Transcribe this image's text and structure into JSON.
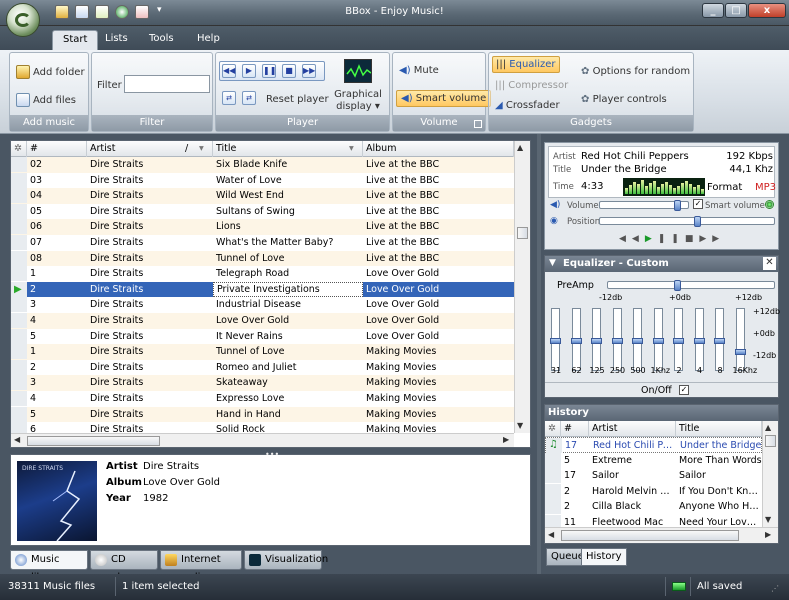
{
  "window": {
    "title": "BBox - Enjoy Music!",
    "close_label": "x",
    "min_label": "_",
    "max_label": "□"
  },
  "ribbon": {
    "tabs": [
      "Start",
      "Lists",
      "Tools",
      "Help"
    ],
    "add_music": {
      "group": "Add music",
      "add_folder": "Add folder",
      "add_files": "Add files"
    },
    "filter": {
      "group": "Filter",
      "label": "Filter",
      "value": ""
    },
    "player": {
      "group": "Player",
      "reset": "Reset player",
      "graphical_display": "Graphical display"
    },
    "volume": {
      "group": "Volume",
      "mute": "Mute",
      "smart_volume": "Smart volume"
    },
    "gadgets": {
      "group": "Gadgets",
      "equalizer": "Equalizer",
      "compressor": "Compressor",
      "crossfader": "Crossfader",
      "options_random": "Options for random",
      "player_controls": "Player controls"
    }
  },
  "list": {
    "columns": [
      "#",
      "Artist",
      "Title",
      "Album"
    ],
    "rows": [
      [
        "02",
        "Dire Straits",
        "Six Blade Knife",
        "Live at the BBC"
      ],
      [
        "03",
        "Dire Straits",
        "Water of Love",
        "Live at the BBC"
      ],
      [
        "04",
        "Dire Straits",
        "Wild West End",
        "Live at the BBC"
      ],
      [
        "05",
        "Dire Straits",
        "Sultans of Swing",
        "Live at the BBC"
      ],
      [
        "06",
        "Dire Straits",
        "Lions",
        "Live at the BBC"
      ],
      [
        "07",
        "Dire Straits",
        "What's the Matter Baby?",
        "Live at the BBC"
      ],
      [
        "08",
        "Dire Straits",
        "Tunnel of Love",
        "Live at the BBC"
      ],
      [
        "1",
        "Dire Straits",
        "Telegraph Road",
        "Love Over Gold"
      ],
      [
        "2",
        "Dire Straits",
        "Private Investigations",
        "Love Over Gold"
      ],
      [
        "3",
        "Dire Straits",
        "Industrial Disease",
        "Love Over Gold"
      ],
      [
        "4",
        "Dire Straits",
        "Love Over Gold",
        "Love Over Gold"
      ],
      [
        "5",
        "Dire Straits",
        "It Never Rains",
        "Love Over Gold"
      ],
      [
        "1",
        "Dire Straits",
        "Tunnel of Love",
        "Making Movies"
      ],
      [
        "2",
        "Dire Straits",
        "Romeo and Juliet",
        "Making Movies"
      ],
      [
        "3",
        "Dire Straits",
        "Skateaway",
        "Making Movies"
      ],
      [
        "4",
        "Dire Straits",
        "Expresso Love",
        "Making Movies"
      ],
      [
        "5",
        "Dire Straits",
        "Hand in Hand",
        "Making Movies"
      ],
      [
        "6",
        "Dire Straits",
        "Solid Rock",
        "Making Movies"
      ]
    ],
    "selected_index": 8,
    "sort_marker": "/"
  },
  "info": {
    "artist_label": "Artist",
    "artist": "Dire Straits",
    "album_label": "Album",
    "album": "Love Over Gold",
    "year_label": "Year",
    "year": "1982",
    "cover_text": "DIRE STRAITS"
  },
  "bottom_tabs": [
    "Music library",
    "CD player",
    "Internet radio",
    "Visualization"
  ],
  "now_playing": {
    "artist_label": "Artist",
    "artist": "Red Hot Chili Peppers",
    "bitrate": "192 Kbps",
    "title_label": "Title",
    "title": "Under the Bridge",
    "khz": "44,1 Khz",
    "time_label": "Time",
    "time": "4:33",
    "format_label": "Format",
    "format": "MP3",
    "volume_label": "Volume",
    "smart_volume_label": "Smart volume",
    "position_label": "Position",
    "volume_level": 0.9,
    "position_level": 0.56
  },
  "equalizer": {
    "title": "Equalizer - Custom",
    "preamp_label": "PreAmp",
    "scale": [
      "-12db",
      "+0db",
      "+12db"
    ],
    "side_scale": [
      "+12db",
      "+0db",
      "-12db"
    ],
    "bands": [
      "31",
      "62",
      "125",
      "250",
      "500",
      "1Khz",
      "2",
      "4",
      "8",
      "16Khz"
    ],
    "levels": [
      0.5,
      0.5,
      0.5,
      0.5,
      0.5,
      0.5,
      0.5,
      0.5,
      0.5,
      0.3
    ],
    "onoff_label": "On/Off"
  },
  "history": {
    "title": "History",
    "columns": [
      "#",
      "Artist",
      "Title"
    ],
    "rows": [
      [
        "17",
        "Red Hot Chili Pep...",
        "Under the Bridge"
      ],
      [
        "5",
        "Extreme",
        "More Than Words"
      ],
      [
        "17",
        "Sailor",
        "Sailor"
      ],
      [
        "2",
        "Harold Melvin & T...",
        "If You Don't Know M"
      ],
      [
        "2",
        "Cilla Black",
        "Anyone Who Had a"
      ],
      [
        "11",
        "Fleetwood Mac",
        "Need Your Love So"
      ]
    ]
  },
  "right_tabs": [
    "Queue",
    "History"
  ],
  "status": {
    "files": "38311 Music files",
    "selected": "1 item selected",
    "saved": "All saved"
  },
  "colors": {
    "accent": "#3465b8",
    "selection_text": "#fff",
    "alt_row": "#fdf5e6",
    "mp3": "#d02020"
  }
}
